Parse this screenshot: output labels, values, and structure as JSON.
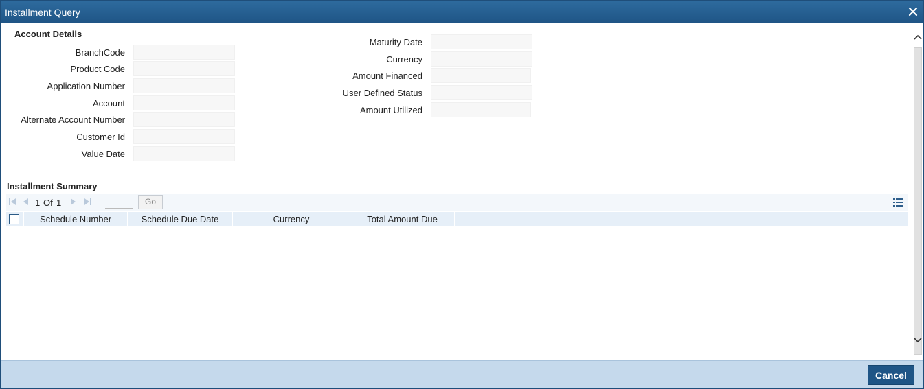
{
  "window": {
    "title": "Installment Query"
  },
  "account_details": {
    "section_title": "Account Details",
    "left_fields": [
      {
        "label": "BranchCode",
        "value": ""
      },
      {
        "label": "Product Code",
        "value": ""
      },
      {
        "label": "Application Number",
        "value": ""
      },
      {
        "label": "Account",
        "value": ""
      },
      {
        "label": "Alternate Account Number",
        "value": ""
      },
      {
        "label": "Customer Id",
        "value": ""
      },
      {
        "label": "Value Date",
        "value": ""
      }
    ],
    "right_fields": [
      {
        "label": "Maturity Date",
        "value": ""
      },
      {
        "label": "Currency",
        "value": ""
      },
      {
        "label": "Amount Financed",
        "value": ""
      },
      {
        "label": "User Defined Status",
        "value": ""
      },
      {
        "label": "Amount Utilized",
        "value": ""
      }
    ]
  },
  "installment_summary": {
    "section_title": "Installment Summary",
    "pagination": {
      "current": "1",
      "of_label": "Of",
      "total": "1",
      "go_label": "Go",
      "page_input": ""
    },
    "columns": [
      "Schedule Number",
      "Schedule Due Date",
      "Currency",
      "Total Amount Due"
    ],
    "rows": []
  },
  "footer": {
    "cancel_label": "Cancel"
  },
  "icons": {
    "close": "close-icon",
    "first": "first-page-icon",
    "prev": "previous-page-icon",
    "next": "next-page-icon",
    "last": "last-page-icon",
    "columns": "column-settings-icon"
  },
  "colors": {
    "titlebar": "#1f5586",
    "footer": "#c5d9ec",
    "button": "#1f5586"
  }
}
